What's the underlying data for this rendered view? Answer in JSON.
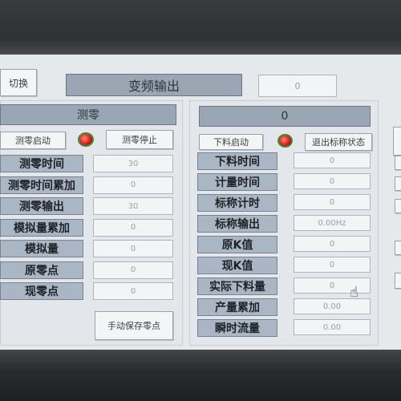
{
  "header": {
    "switch_button": "切换",
    "title": "变频输出",
    "value": "0"
  },
  "left_panel": {
    "title": "测零",
    "start_button": "测零启动",
    "stop_button": "测零停止",
    "rows": [
      {
        "label": "测零时间",
        "value": "30"
      },
      {
        "label": "测零时间累加",
        "value": "0"
      },
      {
        "label": "测零输出",
        "value": "30"
      },
      {
        "label": "模拟量累加",
        "value": "0"
      },
      {
        "label": "模拟量",
        "value": "0"
      },
      {
        "label": "原零点",
        "value": "0"
      },
      {
        "label": "现零点",
        "value": "0"
      }
    ],
    "save_button": "手动保存零点"
  },
  "right_panel": {
    "title": "0",
    "start_button": "下料启动",
    "exit_button": "退出标称状态",
    "rows": [
      {
        "label": "下料时间",
        "value": "0"
      },
      {
        "label": "计量时间",
        "value": "0"
      },
      {
        "label": "标称计时",
        "value": "0"
      },
      {
        "label": "标称输出",
        "value": "0.00Hz"
      },
      {
        "label": "原K值",
        "value": "0"
      },
      {
        "label": "现K值",
        "value": "0"
      },
      {
        "label": "实际下料量",
        "value": "0"
      },
      {
        "label": "产量累加",
        "value": "0.00"
      },
      {
        "label": "瞬时流量",
        "value": "0.00"
      }
    ]
  },
  "colors": {
    "lamp": "#d81f14",
    "label_bg": "#aab6c4",
    "screen_bg": "#e6e9ec"
  }
}
